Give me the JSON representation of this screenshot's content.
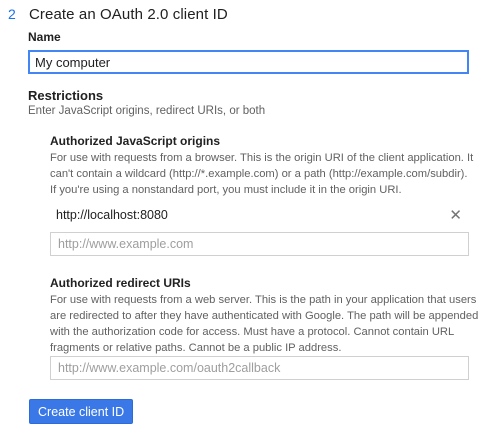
{
  "step": {
    "number": "2",
    "title": "Create an OAuth 2.0 client ID"
  },
  "name": {
    "label": "Name",
    "value": "My computer"
  },
  "restrictions": {
    "title": "Restrictions",
    "subtitle": "Enter JavaScript origins, redirect URIs, or both"
  },
  "js_origins": {
    "title": "Authorized JavaScript origins",
    "description_lines": [
      "For use with requests from a browser. This is the origin URI of the client application. It",
      "can't contain a wildcard (http://*.example.com) or a path (http://example.com/subdir).",
      "If you're using a nonstandard port, you must include it in the origin URI."
    ],
    "entries": [
      "http://localhost:8080"
    ],
    "remove_glyph": "✕",
    "placeholder": "http://www.example.com"
  },
  "redirect_uris": {
    "title": "Authorized redirect URIs",
    "description_lines": [
      "For use with requests from a web server. This is the path in your application that users",
      "are redirected to after they have authenticated with Google. The path will be appended",
      "with the authorization code for access. Must have a protocol. Cannot contain URL",
      "fragments or relative paths. Cannot be a public IP address."
    ],
    "placeholder": "http://www.example.com/oauth2callback"
  },
  "actions": {
    "create_label": "Create client ID"
  },
  "colors": {
    "accent": "#1a73e8",
    "primary_button": "#3b78e7",
    "focused_border": "#4285f4"
  }
}
